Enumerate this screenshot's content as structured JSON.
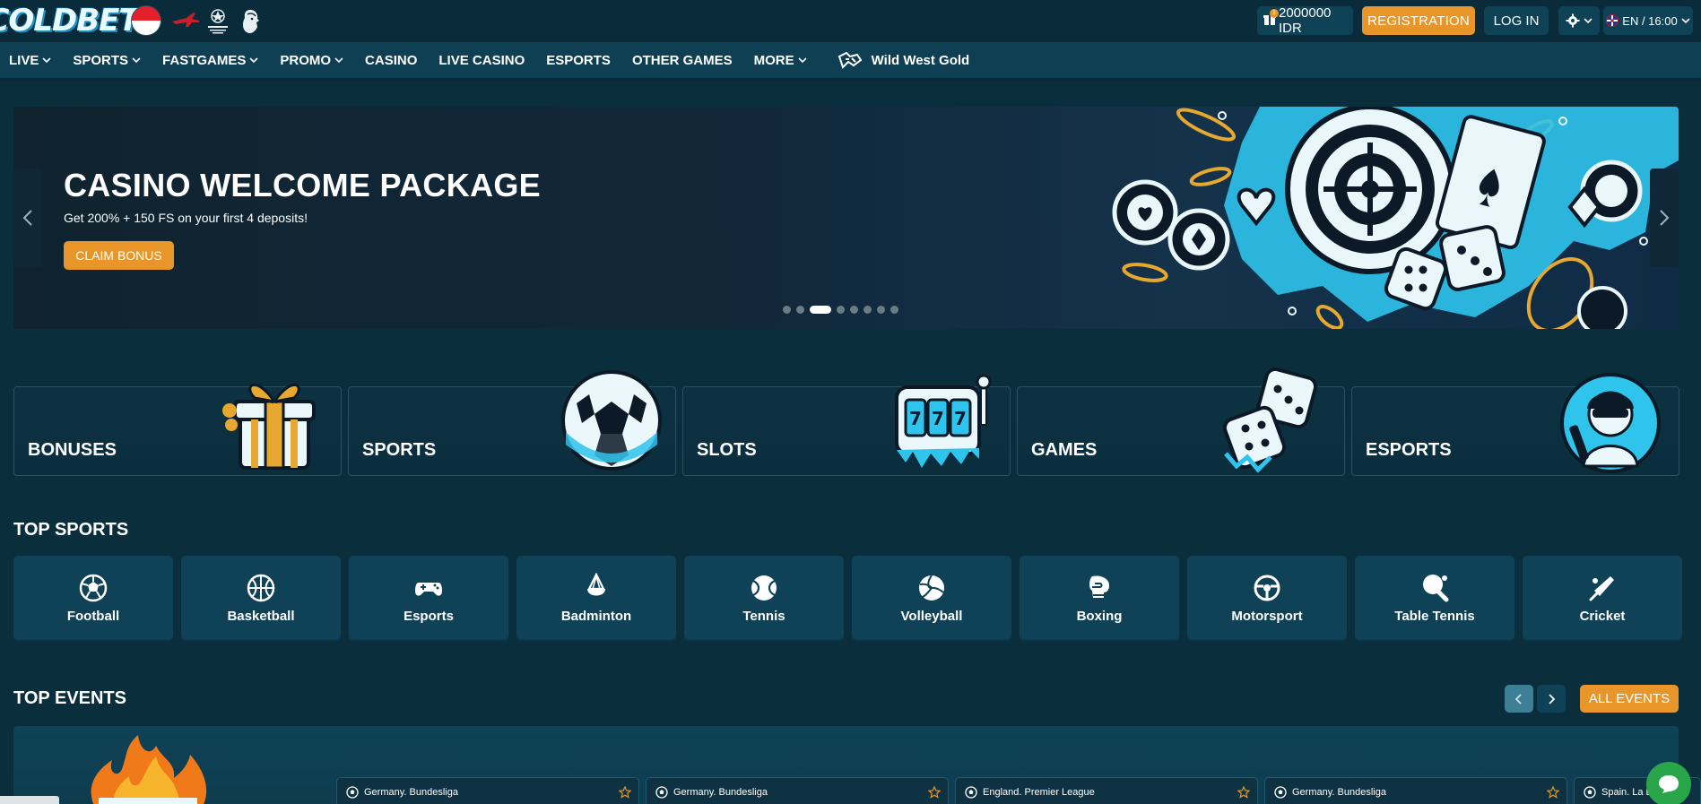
{
  "brand": {
    "logo_text": "COLDBET"
  },
  "header": {
    "balance": "2000000 IDR",
    "gift_count": "1",
    "registration_label": "REGISTRATION",
    "login_label": "LOG IN",
    "language_time": "EN / 16:00"
  },
  "nav": {
    "items": [
      {
        "label": "LIVE",
        "dropdown": true
      },
      {
        "label": "SPORTS",
        "dropdown": true
      },
      {
        "label": "FASTGAMES",
        "dropdown": true
      },
      {
        "label": "PROMO",
        "dropdown": true
      },
      {
        "label": "CASINO",
        "dropdown": false
      },
      {
        "label": "LIVE CASINO",
        "dropdown": false
      },
      {
        "label": "ESPORTS",
        "dropdown": false
      },
      {
        "label": "OTHER GAMES",
        "dropdown": false
      },
      {
        "label": "MORE",
        "dropdown": true
      }
    ],
    "featured": "Wild West Gold"
  },
  "hero": {
    "title": "CASINO WELCOME PACKAGE",
    "subtitle": "Get 200% + 150 FS on your first 4 deposits!",
    "cta": "CLAIM BONUS",
    "slide_count": 8,
    "active_slide": 3
  },
  "categories": [
    "BONUSES",
    "SPORTS",
    "SLOTS",
    "GAMES",
    "ESPORTS"
  ],
  "top_sports": {
    "title": "TOP SPORTS",
    "items": [
      {
        "label": "Football",
        "icon": "football-icon"
      },
      {
        "label": "Basketball",
        "icon": "basketball-icon"
      },
      {
        "label": "Esports",
        "icon": "gamepad-icon"
      },
      {
        "label": "Badminton",
        "icon": "shuttlecock-icon"
      },
      {
        "label": "Tennis",
        "icon": "tennis-ball-icon"
      },
      {
        "label": "Volleyball",
        "icon": "volleyball-icon"
      },
      {
        "label": "Boxing",
        "icon": "boxing-glove-icon"
      },
      {
        "label": "Motorsport",
        "icon": "steering-wheel-icon"
      },
      {
        "label": "Table Tennis",
        "icon": "ping-pong-icon"
      },
      {
        "label": "Cricket",
        "icon": "cricket-bat-icon"
      }
    ]
  },
  "top_events": {
    "title": "TOP EVENTS",
    "all_label": "ALL EVENTS",
    "events": [
      {
        "league": "Germany. Bundesliga"
      },
      {
        "league": "Germany. Bundesliga"
      },
      {
        "league": "England. Premier League"
      },
      {
        "league": "Germany. Bundesliga"
      },
      {
        "league": "Spain. La L"
      }
    ]
  },
  "colors": {
    "background": "#0b2e3d",
    "accent": "#e8962a",
    "tile": "#0f4256",
    "chat": "#2aa64a"
  }
}
